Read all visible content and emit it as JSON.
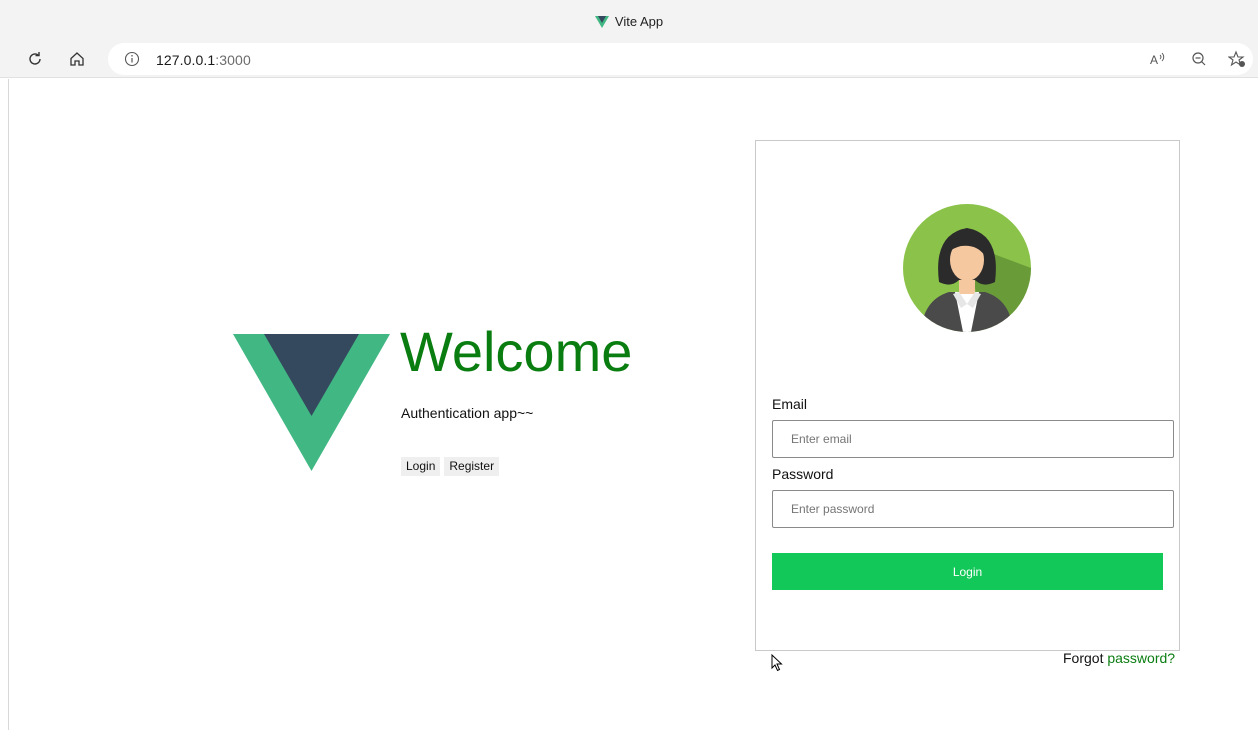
{
  "browser": {
    "tab_title": "Vite App",
    "url_host": "127.0.0.1",
    "url_port": ":3000"
  },
  "hero": {
    "title": "Welcome",
    "subtitle": "Authentication app~~",
    "login_button": "Login",
    "register_button": "Register",
    "logo_colors": {
      "outer": "#41b883",
      "inner": "#34495e"
    }
  },
  "login_form": {
    "email_label": "Email",
    "email_placeholder": "Enter email",
    "password_label": "Password",
    "password_placeholder": "Enter password",
    "submit_label": "Login",
    "submit_color": "#12c858"
  },
  "footer": {
    "forgot_text": "Forgot",
    "forgot_link": "password?"
  },
  "colors": {
    "accent": "#0a7d10"
  }
}
